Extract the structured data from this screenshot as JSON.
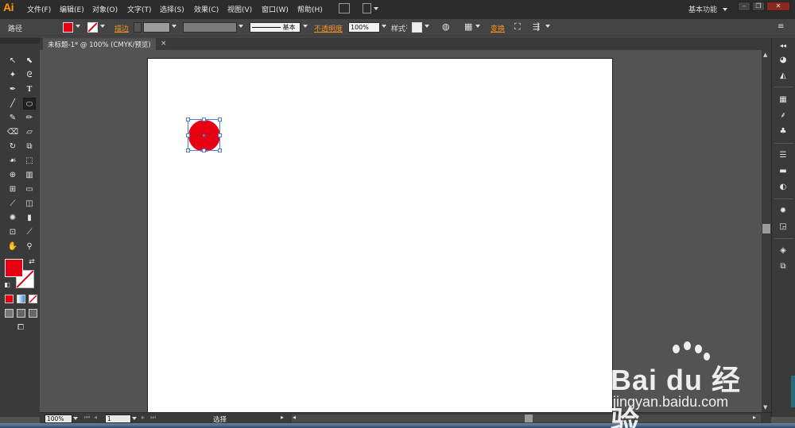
{
  "app": {
    "logo": "Ai"
  },
  "menu": [
    "文件(F)",
    "编辑(E)",
    "对象(O)",
    "文字(T)",
    "选择(S)",
    "效果(C)",
    "视图(V)",
    "窗口(W)",
    "帮助(H)"
  ],
  "workspace": "基本功能",
  "controls": {
    "selection_type": "路径",
    "stroke_label": "描边",
    "style_name": "基本",
    "opacity_label": "不透明度",
    "opacity_value": "100%",
    "style_label": "样式",
    "transform_label": "变换"
  },
  "document": {
    "tab_title": "未标题-1* @ 100% (CMYK/预览)",
    "close": "×"
  },
  "status": {
    "zoom": "100%",
    "page": "1",
    "text": "选择"
  },
  "colors": {
    "fill": "#e60012",
    "accent": "#f7931e",
    "selection": "#4a7bd8"
  },
  "watermark": {
    "logo": "Bai du 经验",
    "url": "jingyan.baidu.com"
  },
  "tools": [
    "selection-tool",
    "direct-selection-tool",
    "magic-wand-tool",
    "lasso-tool",
    "pen-tool",
    "type-tool",
    "line-tool",
    "ellipse-tool",
    "paintbrush-tool",
    "pencil-tool",
    "blob-brush-tool",
    "eraser-tool",
    "rotate-tool",
    "scale-tool",
    "warp-tool",
    "free-transform-tool",
    "shape-builder-tool",
    "perspective-grid-tool",
    "mesh-tool",
    "gradient-tool",
    "eyedropper-tool",
    "blend-tool",
    "symbol-sprayer-tool",
    "column-graph-tool",
    "artboard-tool",
    "slice-tool",
    "hand-tool",
    "zoom-tool"
  ]
}
